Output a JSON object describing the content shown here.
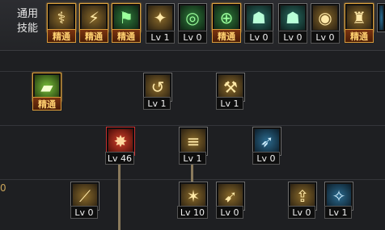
{
  "top": {
    "label_line1": "通用",
    "label_line2": "技能"
  },
  "row_marker": "0",
  "colors": {
    "mastered_border": "#d9a03c",
    "connector": "#8a7a5c"
  },
  "skills_top": [
    {
      "icon": "figure-icon",
      "glyph": "⚕",
      "badge": "精通",
      "mastered": true
    },
    {
      "icon": "sprint-icon",
      "glyph": "⚡",
      "badge": "精通",
      "mastered": true
    },
    {
      "icon": "runner-icon",
      "glyph": "⚑",
      "badge": "精通",
      "mastered": true
    },
    {
      "icon": "wings-icon",
      "glyph": "✦",
      "badge": "Lv 1",
      "mastered": false
    },
    {
      "icon": "target-icon",
      "glyph": "◎",
      "badge": "Lv 0",
      "mastered": false
    },
    {
      "icon": "crosshair-icon",
      "glyph": "⊕",
      "badge": "精通",
      "mastered": true
    },
    {
      "icon": "ghost-icon",
      "glyph": "☗",
      "badge": "Lv 0",
      "mastered": false
    },
    {
      "icon": "ghost-run-icon",
      "glyph": "☗",
      "badge": "Lv 0",
      "mastered": false
    },
    {
      "icon": "eye-icon",
      "glyph": "◉",
      "badge": "Lv 0",
      "mastered": false
    },
    {
      "icon": "warrior-icon",
      "glyph": "♜",
      "badge": "精通",
      "mastered": true
    }
  ],
  "skills_tree": [
    {
      "icon": "book-icon",
      "glyph": "▰",
      "badge": "精通",
      "mastered": true
    },
    {
      "icon": "spin-kick-icon",
      "glyph": "↺",
      "badge": "Lv 1",
      "mastered": false
    },
    {
      "icon": "leap-icon",
      "glyph": "⚒",
      "badge": "Lv 1",
      "mastered": false
    },
    {
      "icon": "explosion-icon",
      "glyph": "✸",
      "badge": "Lv 46",
      "mastered": false
    },
    {
      "icon": "dash-icon",
      "glyph": "≡",
      "badge": "Lv 1",
      "mastered": false
    },
    {
      "icon": "glide-icon",
      "glyph": "➶",
      "badge": "Lv 0",
      "mastered": false
    },
    {
      "icon": "blade-icon",
      "glyph": "⟋",
      "badge": "Lv 0",
      "mastered": false
    },
    {
      "icon": "strike-icon",
      "glyph": "✶",
      "badge": "Lv 10",
      "mastered": false
    },
    {
      "icon": "arrow-icon",
      "glyph": "➹",
      "badge": "Lv 0",
      "mastered": false
    },
    {
      "icon": "rise-icon",
      "glyph": "⇪",
      "badge": "Lv 0",
      "mastered": false
    },
    {
      "icon": "wind-icon",
      "glyph": "✧",
      "badge": "Lv 1",
      "mastered": false
    }
  ]
}
